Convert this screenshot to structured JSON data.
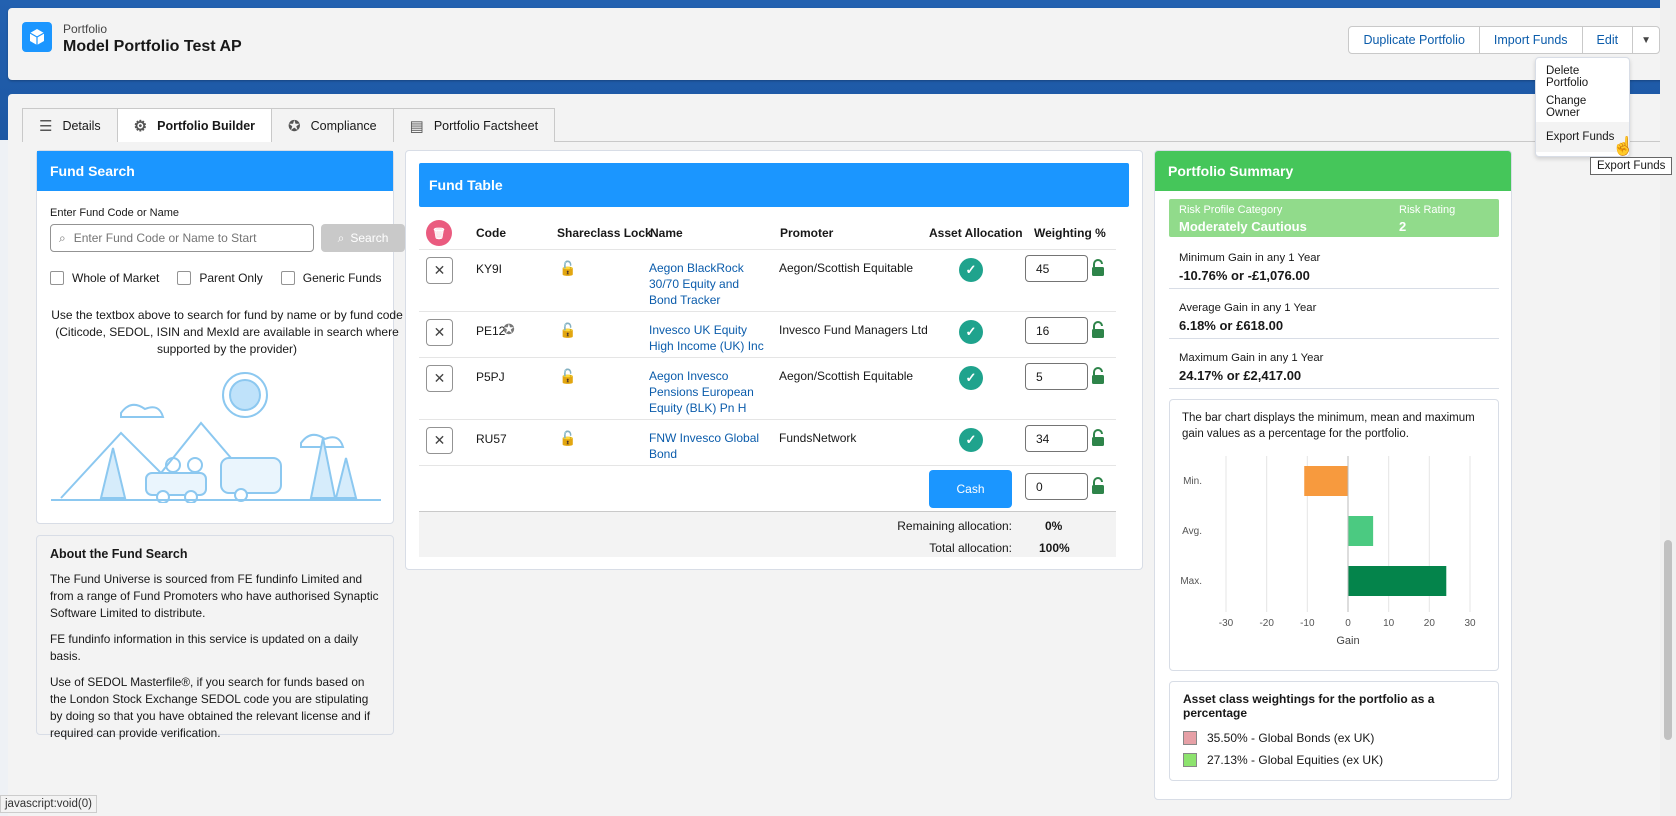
{
  "header": {
    "object_type": "Portfolio",
    "title": "Model Portfolio Test AP",
    "buttons": {
      "duplicate": "Duplicate Portfolio",
      "import": "Import Funds",
      "edit": "Edit"
    }
  },
  "menu": {
    "items": [
      "Delete Portfolio",
      "Change Owner",
      "Export Funds"
    ],
    "tooltip": "Export Funds"
  },
  "tabs": [
    "Details",
    "Portfolio Builder",
    "Compliance",
    "Portfolio Factsheet"
  ],
  "fund_search": {
    "title": "Fund Search",
    "label": "Enter Fund Code or Name",
    "placeholder": "Enter Fund Code or Name to Start",
    "search_label": "Search",
    "checkboxes": [
      "Whole of Market",
      "Parent Only",
      "Generic Funds"
    ],
    "help": "Use the textbox above to search for fund by name or by fund code (Citicode, SEDOL, ISIN and MexId are available in search where supported by the provider)"
  },
  "about": {
    "title": "About the Fund Search",
    "p1": "The Fund Universe is sourced from FE fundinfo Limited and from a range of Fund Promoters who have authorised Synaptic Software Limited to distribute.",
    "p2": "FE fundinfo information in this service is updated on a daily basis.",
    "p3": "Use of SEDOL Masterfile®, if you search for funds based on the London Stock Exchange SEDOL code you are stipulating by doing so that you have obtained the relevant license and if required can provide verification."
  },
  "fund_table": {
    "title": "Fund Table",
    "columns": {
      "code": "Code",
      "lock": "Shareclass Lock",
      "name": "Name",
      "promoter": "Promoter",
      "allocation": "Asset Allocation",
      "weighting": "Weighting %"
    },
    "rows": [
      {
        "code": "KY9I",
        "name": "Aegon BlackRock 30/70 Equity and Bond Tracker",
        "promoter": "Aegon/Scottish Equitable",
        "weight": "45"
      },
      {
        "code": "PE12",
        "name": "Invesco UK Equity High Income (UK) Inc",
        "promoter": "Invesco Fund Managers Ltd",
        "weight": "16"
      },
      {
        "code": "P5PJ",
        "name": "Aegon Invesco Pensions European Equity (BLK) Pn H",
        "promoter": "Aegon/Scottish Equitable",
        "weight": "5"
      },
      {
        "code": "RU57",
        "name": "FNW Invesco Global Bond",
        "promoter": "FundsNetwork",
        "weight": "34"
      }
    ],
    "cash_label": "Cash",
    "cash_weight": "0",
    "remaining_label": "Remaining allocation:",
    "remaining_value": "0%",
    "total_label": "Total allocation:",
    "total_value": "100%"
  },
  "summary": {
    "title": "Portfolio Summary",
    "risk_category_label": "Risk Profile Category",
    "risk_category": "Moderately Cautious",
    "risk_rating_label": "Risk Rating",
    "risk_rating": "2",
    "min_label": "Minimum Gain in any 1 Year",
    "min_value": "-10.76% or -£1,076.00",
    "avg_label": "Average Gain in any 1 Year",
    "avg_value": "6.18% or £618.00",
    "max_label": "Maximum Gain in any 1 Year",
    "max_value": "24.17% or £2,417.00",
    "chart_desc": "The bar chart displays the minimum, mean and maximum gain values as a percentage for the portfolio.",
    "asset_title": "Asset class weightings for the portfolio as a percentage",
    "assets": [
      {
        "label": "35.50% - Global Bonds (ex UK)",
        "color": "#e6a0a6"
      },
      {
        "label": "27.13% - Global Equities (ex UK)",
        "color": "#8de36e"
      }
    ]
  },
  "chart_data": {
    "type": "bar",
    "orientation": "horizontal",
    "categories": [
      "Min.",
      "Avg.",
      "Max."
    ],
    "values": [
      -10.76,
      6.18,
      24.17
    ],
    "colors": [
      "#f79a3e",
      "#4bca81",
      "#04844b"
    ],
    "xlabel": "Gain",
    "xlim": [
      -30,
      30
    ],
    "xticks": [
      -30,
      -20,
      -10,
      0,
      10,
      20,
      30
    ],
    "grid": true
  },
  "status_bar": "javascript:void(0)"
}
